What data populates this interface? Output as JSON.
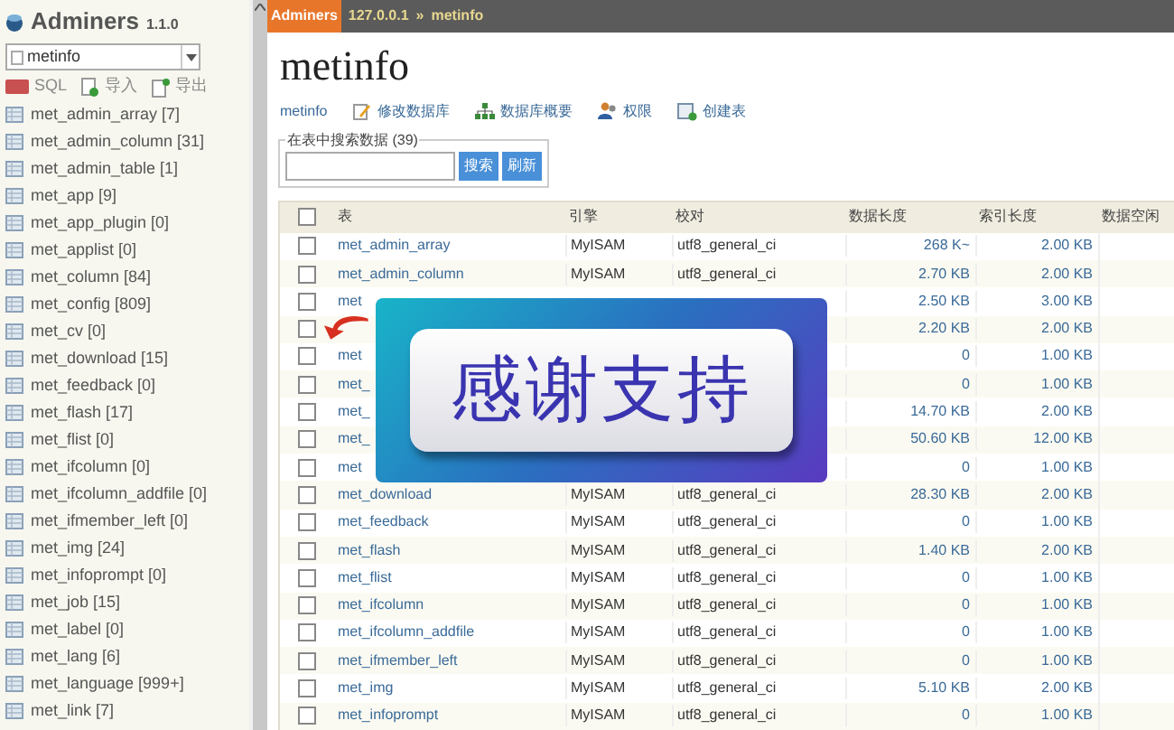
{
  "sidebar": {
    "app_name": "Adminers",
    "version": "1.1.0",
    "database_select": "metinfo",
    "actions": [
      "SQL",
      "导入",
      "导出"
    ],
    "tables": [
      "met_admin_array [7]",
      "met_admin_column [31]",
      "met_admin_table [1]",
      "met_app [9]",
      "met_app_plugin [0]",
      "met_applist [0]",
      "met_column [84]",
      "met_config [809]",
      "met_cv [0]",
      "met_download [15]",
      "met_feedback [0]",
      "met_flash [17]",
      "met_flist [0]",
      "met_ifcolumn [0]",
      "met_ifcolumn_addfile [0]",
      "met_ifmember_left [0]",
      "met_img [24]",
      "met_infoprompt [0]",
      "met_job [15]",
      "met_label [0]",
      "met_lang [6]",
      "met_language [999+]",
      "met_link [7]"
    ]
  },
  "breadcrumb": [
    "Adminers",
    "127.0.0.1",
    "»",
    "metinfo"
  ],
  "title": "metinfo",
  "links": [
    {
      "kind": "plain",
      "label": "metinfo"
    },
    {
      "kind": "edit",
      "label": "修改数据库"
    },
    {
      "kind": "schema",
      "label": "数据库概要"
    },
    {
      "kind": "privileges",
      "label": "权限"
    },
    {
      "kind": "create",
      "label": "创建表"
    }
  ],
  "search": {
    "legend": "在表中搜索数据 (39)",
    "buttons": [
      "搜索",
      "刷新"
    ]
  },
  "table": {
    "header_checked": false,
    "columns": [
      "表",
      "引擎",
      "校对",
      "数据长度",
      "索引长度",
      "数据空闲"
    ],
    "rows": [
      {
        "checked": false,
        "name": "met_admin_array",
        "engine": "MyISAM",
        "collation": "utf8_general_ci",
        "data_length": "268 K~",
        "index_length": "2.00 KB"
      },
      {
        "checked": false,
        "name": "met_admin_column",
        "engine": "MyISAM",
        "collation": "utf8_general_ci",
        "data_length": "2.70 KB",
        "index_length": "2.00 KB"
      },
      {
        "checked": false,
        "name": "met",
        "data_length": "2.50 KB",
        "index_length": "3.00 KB"
      },
      {
        "checked": false,
        "data_length": "2.20 KB",
        "index_length": "2.00 KB"
      },
      {
        "checked": false,
        "name": "met",
        "data_length": "0",
        "index_length": "1.00 KB"
      },
      {
        "checked": false,
        "name": "met_",
        "data_length": "0",
        "index_length": "1.00 KB"
      },
      {
        "checked": false,
        "name": "met_",
        "data_length": "14.70 KB",
        "index_length": "2.00 KB"
      },
      {
        "checked": false,
        "name": "met_",
        "data_length": "50.60 KB",
        "index_length": "12.00 KB"
      },
      {
        "checked": false,
        "name": "met",
        "data_length": "0",
        "index_length": "1.00 KB"
      },
      {
        "checked": false,
        "name": "met_download",
        "engine": "MyISAM",
        "collation": "utf8_general_ci",
        "data_length": "28.30 KB",
        "index_length": "2.00 KB"
      },
      {
        "checked": false,
        "name": "met_feedback",
        "engine": "MyISAM",
        "collation": "utf8_general_ci",
        "data_length": "0",
        "index_length": "1.00 KB"
      },
      {
        "checked": false,
        "name": "met_flash",
        "engine": "MyISAM",
        "collation": "utf8_general_ci",
        "data_length": "1.40 KB",
        "index_length": "2.00 KB"
      },
      {
        "checked": false,
        "name": "met_flist",
        "engine": "MyISAM",
        "collation": "utf8_general_ci",
        "data_length": "0",
        "index_length": "1.00 KB"
      },
      {
        "checked": false,
        "name": "met_ifcolumn",
        "engine": "MyISAM",
        "collation": "utf8_general_ci",
        "data_length": "0",
        "index_length": "1.00 KB"
      },
      {
        "checked": false,
        "name": "met_ifcolumn_addfile",
        "engine": "MyISAM",
        "collation": "utf8_general_ci",
        "data_length": "0",
        "index_length": "1.00 KB"
      },
      {
        "checked": false,
        "name": "met_ifmember_left",
        "engine": "MyISAM",
        "collation": "utf8_general_ci",
        "data_length": "0",
        "index_length": "1.00 KB"
      },
      {
        "checked": false,
        "name": "met_img",
        "engine": "MyISAM",
        "collation": "utf8_general_ci",
        "data_length": "5.10 KB",
        "index_length": "2.00 KB"
      },
      {
        "checked": false,
        "name": "met_infoprompt",
        "engine": "MyISAM",
        "collation": "utf8_general_ci",
        "data_length": "0",
        "index_length": "1.00 KB"
      }
    ]
  },
  "overlay": {
    "text": "感谢支持"
  }
}
